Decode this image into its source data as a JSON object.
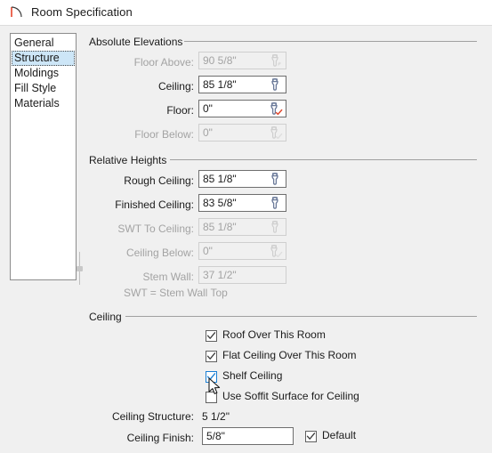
{
  "window": {
    "title": "Room Specification",
    "icon": "door-swing-icon"
  },
  "sidebar": {
    "items": [
      {
        "label": "General",
        "selected": false
      },
      {
        "label": "Structure",
        "selected": true
      },
      {
        "label": "Moldings",
        "selected": false
      },
      {
        "label": "Fill Style",
        "selected": false
      },
      {
        "label": "Materials",
        "selected": false
      }
    ]
  },
  "groups": {
    "absolute_elevations": {
      "title": "Absolute Elevations",
      "fields": [
        {
          "label": "Floor Above:",
          "value": "90 5/8\"",
          "enabled": false,
          "icon": "wrench-icon",
          "has_icon": true
        },
        {
          "label": "Ceiling:",
          "value": "85 1/8\"",
          "enabled": true,
          "icon": "wrench-icon",
          "has_icon": true
        },
        {
          "label": "Floor:",
          "value": "0\"",
          "enabled": true,
          "icon": "wrench-check-icon",
          "has_icon": true
        },
        {
          "label": "Floor Below:",
          "value": "0\"",
          "enabled": false,
          "icon": "wrench-check-icon",
          "has_icon": true
        }
      ]
    },
    "relative_heights": {
      "title": "Relative Heights",
      "fields": [
        {
          "label": "Rough Ceiling:",
          "value": "85 1/8\"",
          "enabled": true,
          "icon": "wrench-icon",
          "has_icon": true
        },
        {
          "label": "Finished Ceiling:",
          "value": "83 5/8\"",
          "enabled": true,
          "icon": "wrench-icon",
          "has_icon": true
        },
        {
          "label": "SWT To Ceiling:",
          "value": "85 1/8\"",
          "enabled": false,
          "icon": "wrench-icon",
          "has_icon": true
        },
        {
          "label": "Ceiling Below:",
          "value": "0\"",
          "enabled": false,
          "icon": "wrench-check-icon",
          "has_icon": true
        },
        {
          "label": "Stem Wall:",
          "value": "37 1/2\"",
          "enabled": false,
          "icon": "",
          "has_icon": false
        }
      ],
      "note": "SWT = Stem Wall Top"
    },
    "ceiling": {
      "title": "Ceiling",
      "checkboxes": [
        {
          "label": "Roof Over This Room",
          "checked": true,
          "hover": false
        },
        {
          "label": "Flat Ceiling Over This Room",
          "checked": true,
          "hover": false
        },
        {
          "label": "Shelf Ceiling",
          "checked": true,
          "hover": true
        },
        {
          "label": "Use Soffit Surface for Ceiling",
          "checked": false,
          "hover": false
        }
      ],
      "ceiling_structure_label": "Ceiling Structure:",
      "ceiling_structure_value": "5 1/2\"",
      "ceiling_finish_label": "Ceiling Finish:",
      "ceiling_finish_value": "5/8\"",
      "default_label": "Default",
      "default_checked": true
    }
  },
  "colors": {
    "selection": "#cde6f7",
    "hover_accent": "#1a7fd4",
    "icon_blue": "#6b7a99",
    "icon_red": "#e04a2f",
    "window_bg": "#f0f0f0",
    "disabled_text": "#a3a3a3"
  }
}
